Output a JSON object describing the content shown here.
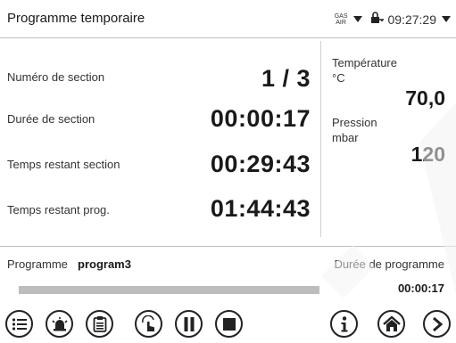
{
  "header": {
    "title": "Programme temporaire",
    "gas_line1": "GAS",
    "gas_line2": "AIR",
    "time": "09:27:29"
  },
  "section": {
    "rows": [
      {
        "label": "Numéro de section",
        "value": "1 / 3"
      },
      {
        "label": "Durée de section",
        "value": "00:00:17"
      },
      {
        "label": "Temps restant section",
        "value": "00:29:43"
      },
      {
        "label": "Temps restant prog.",
        "value": "01:44:43"
      }
    ]
  },
  "sensors": {
    "temperature": {
      "label": "Température",
      "unit": "°C",
      "value": "70,0"
    },
    "pressure": {
      "label": "Pression",
      "unit": "mbar",
      "value": "120"
    }
  },
  "program": {
    "label": "Programme",
    "name": "program3",
    "duration_label": "Durée de programme",
    "duration_value": "00:00:17",
    "progress_fraction": 1.0
  },
  "toolbar": {
    "icons": [
      "menu-list-icon",
      "alarm-bell-icon",
      "clipboard-icon",
      "manual-touch-icon",
      "pause-icon",
      "stop-icon",
      "info-icon",
      "home-icon",
      "next-arrow-icon"
    ]
  }
}
